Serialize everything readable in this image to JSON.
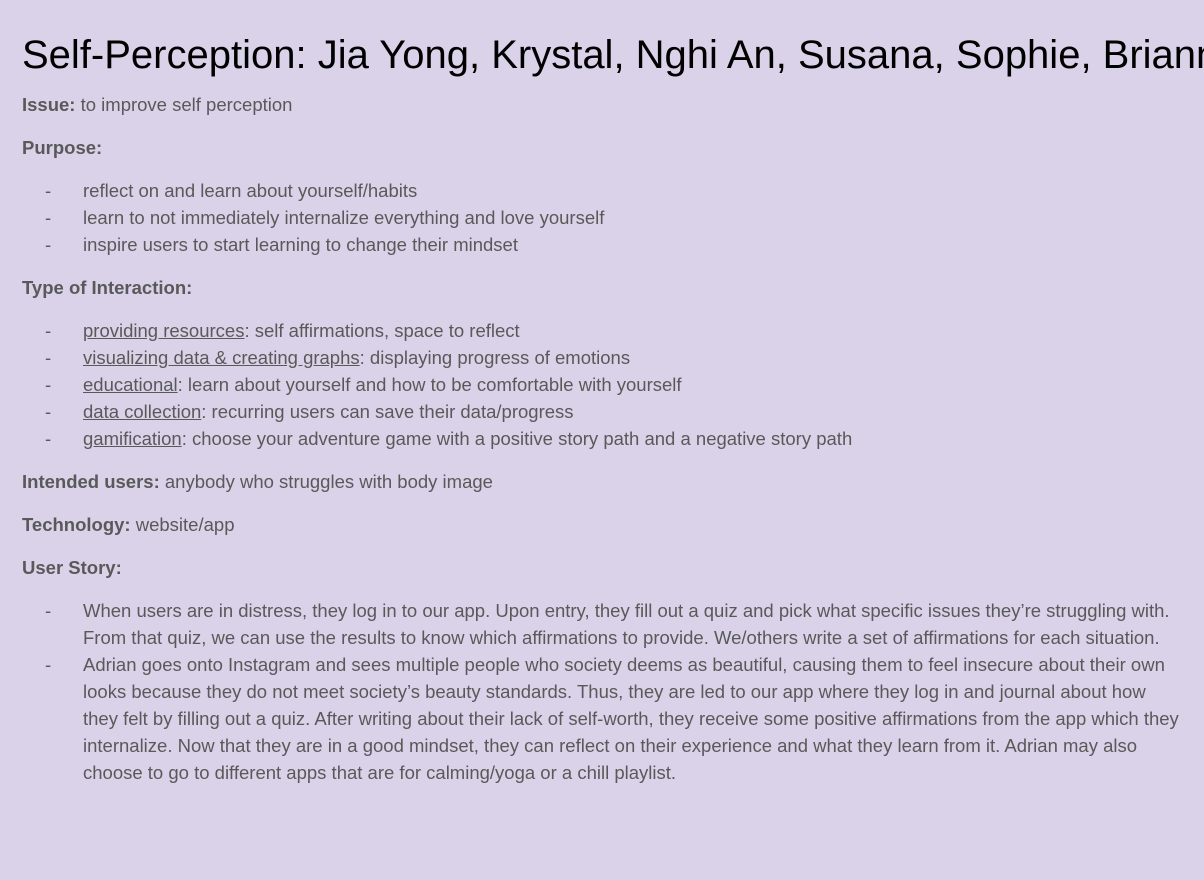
{
  "title": "Self-Perception: Jia Yong, Krystal, Nghi An, Susana, Sophie, Brianna",
  "bullet": "-",
  "issue": {
    "label": "Issue:",
    "text": " to improve self perception"
  },
  "purpose": {
    "label": "Purpose:",
    "items": [
      "reflect on and learn about yourself/habits",
      "learn to not immediately internalize everything and love yourself",
      "inspire users to start learning to change their mindset"
    ]
  },
  "interaction": {
    "label": "Type of Interaction:",
    "items": [
      {
        "term": "providing resources",
        "text": ": self affirmations, space to reflect"
      },
      {
        "term": "visualizing data & creating graphs",
        "text": ": displaying progress of emotions"
      },
      {
        "term": "educational",
        "text": ": learn about yourself and how to be comfortable with yourself"
      },
      {
        "term": "data collection",
        "text": ": recurring users can save their data/progress"
      },
      {
        "term": "gamification",
        "text": ": choose your adventure game with a positive story path and a negative story path"
      }
    ]
  },
  "intended_users": {
    "label": "Intended users:",
    "text": " anybody who struggles with body image"
  },
  "technology": {
    "label": "Technology:",
    "text": " website/app"
  },
  "user_story": {
    "label": "User Story:",
    "items": [
      "When users are in distress, they log in to our app. Upon entry, they fill out a quiz and pick what specific issues they’re struggling with. From that quiz, we can use the results to know which affirmations to provide. We/others write a set of affirmations for each situation.",
      "Adrian goes onto Instagram and sees multiple people who society deems as beautiful, causing them to feel insecure about their own looks because they do not meet society’s beauty standards. Thus, they are led to our app where they log in and journal about how they felt by filling out a quiz. After writing about their lack of self-worth, they receive some positive affirmations from the app which they internalize. Now that they are in a good mindset, they can reflect on their experience and what they learn from it. Adrian may also choose to go to different apps that are for calming/yoga or a chill playlist."
    ]
  }
}
